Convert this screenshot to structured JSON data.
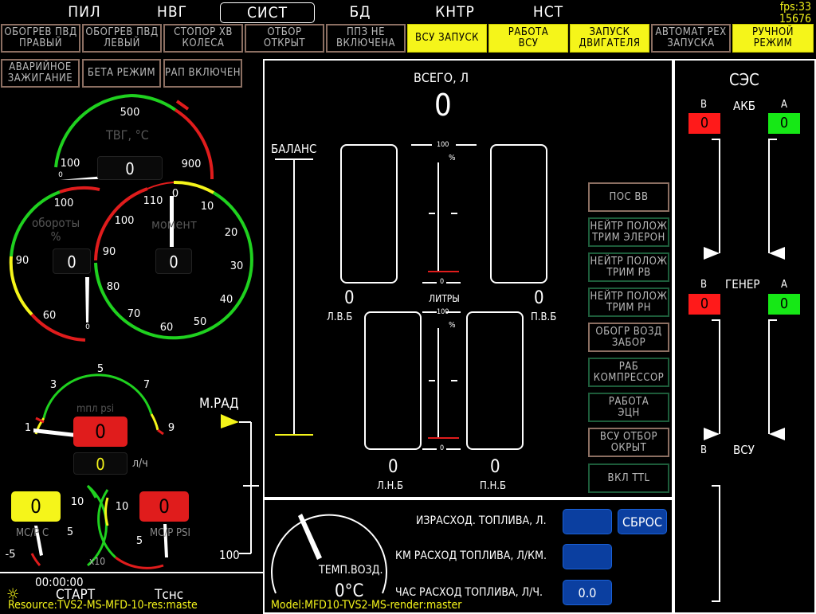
{
  "tabs": [
    {
      "label": "ПИЛ"
    },
    {
      "label": "НВГ"
    },
    {
      "label": "СИСТ",
      "selected": true
    },
    {
      "label": "БД"
    },
    {
      "label": "КНТР"
    },
    {
      "label": "НСТ"
    }
  ],
  "fps": {
    "label": "fps:33",
    "value": "15676"
  },
  "status_row1": [
    {
      "label": "ОБОГРЕВ ПВД\nПРАВЫЙ",
      "state": "off"
    },
    {
      "label": "ОБОГРЕВ ПВД\nЛЕВЫЙ",
      "state": "off"
    },
    {
      "label": "СТОПОР ХВ\nКОЛЕСА",
      "state": "off"
    },
    {
      "label": "ОТБОР\nОТКРЫТ",
      "state": "off"
    },
    {
      "label": "ППЗ НЕ\nВКЛЮЧЕНА",
      "state": "off"
    },
    {
      "label": "ВСУ ЗАПУСК",
      "state": "on"
    },
    {
      "label": "РАБОТА\nВСУ",
      "state": "on"
    },
    {
      "label": "ЗАПУСК\nДВИГАТЕЛЯ",
      "state": "on"
    },
    {
      "label": "АВТОМАТ РЕХ\nЗАПУСКА",
      "state": "off"
    },
    {
      "label": "РУЧНОЙ\nРЕЖИМ",
      "state": "on"
    }
  ],
  "status_row2": [
    {
      "label": "АВАРИЙНОЕ\nЗАЖИГАНИЕ"
    },
    {
      "label": "БЕТА РЕЖИМ"
    },
    {
      "label": "РАП ВКЛЮЧЕН"
    }
  ],
  "gauges": {
    "tvg": {
      "label": "ТВГ, °С",
      "value": "0",
      "ticks": [
        "500",
        "100",
        "900"
      ],
      "small": "0",
      "extra": "105"
    },
    "oboroty": {
      "label": "обороты\n%",
      "value": "0",
      "ticks": [
        "100",
        "90",
        "60"
      ],
      "small": "0"
    },
    "moment": {
      "label": "момент",
      "value": "0",
      "ticks": [
        "110",
        "0",
        "100",
        "10",
        "90",
        "20",
        "80",
        "30",
        "70",
        "40",
        "60",
        "50"
      ]
    },
    "oil": {
      "label": "mпл psi",
      "value": "0",
      "ticks": [
        "5",
        "3",
        "7",
        "1",
        "9"
      ]
    },
    "fuel_flow": {
      "value": "0",
      "unit": "л/ч"
    },
    "vsi": {
      "value": "0",
      "label": "МС/Р С",
      "ticks": [
        "10",
        "5",
        "-5"
      ],
      "mult": "x10"
    },
    "psi": {
      "value": "0",
      "label": "МС/Р PSI",
      "ticks": [
        "10",
        "5"
      ]
    }
  },
  "mrad": {
    "label": "М.РАД",
    "value": "100"
  },
  "timer": {
    "time": "00:00:00",
    "start": "СТАРТ",
    "tsns": "Тснс"
  },
  "resource": "Resource:TVS2-MS-MFD-10-res:maste",
  "model": "Model:MFD10-TVS2-MS-render:master",
  "fuel": {
    "total_label": "ВСЕГО, Л",
    "total": "0",
    "balance": "БАЛАНС",
    "lvb": {
      "value": "0",
      "label": "Л.В.Б"
    },
    "pvb": {
      "value": "0",
      "label": "П.В.Б"
    },
    "lnb": {
      "value": "0",
      "label": "Л.Н.Б"
    },
    "pnb": {
      "value": "0",
      "label": "П.Н.Б"
    },
    "litres": "ЛИТРЫ",
    "pct": "%",
    "p100": "100",
    "p0": "0"
  },
  "side_buttons": [
    {
      "label": "ПОС ВВ",
      "style": "brn"
    },
    {
      "label": "НЕЙТР ПОЛОЖ\nТРИМ ЭЛЕРОН",
      "style": "grn"
    },
    {
      "label": "НЕЙТР ПОЛОЖ\nТРИМ РВ",
      "style": "grn"
    },
    {
      "label": "НЕЙТР ПОЛОЖ\nТРИМ РН",
      "style": "grn"
    },
    {
      "label": "ОБОГР ВОЗД\nЗАБОР",
      "style": "brn"
    },
    {
      "label": "РАБ\nКОМПРЕССОР",
      "style": "grn"
    },
    {
      "label": "РАБОТА\nЭЦН",
      "style": "grn"
    },
    {
      "label": "ВСУ ОТБОР\nОКРЫТ",
      "style": "brn"
    },
    {
      "label": "ВКЛ TTL",
      "style": "grn"
    }
  ],
  "consumption": {
    "temp_label": "ТЕМП.ВОЗД.",
    "temp_value": "0°С",
    "spent": "ИЗРАСХОД. ТОПЛИВА, Л.",
    "reset": "СБРОС",
    "km": "КМ РАСХОД ТОПЛИВА, Л/КМ.",
    "hour": "ЧАС РАСХОД ТОПЛИВА, Л/Ч.",
    "hour_value": "0.0"
  },
  "ses": {
    "title": "СЭС",
    "akb": "АКБ",
    "gener": "ГЕНЕР",
    "vsu": "ВСУ",
    "v": "В",
    "a": "А",
    "akb_v": "0",
    "akb_a": "0",
    "gen_v": "0",
    "gen_a": "0",
    "v_color": "#ff1a1a",
    "a_color": "#16e816"
  }
}
